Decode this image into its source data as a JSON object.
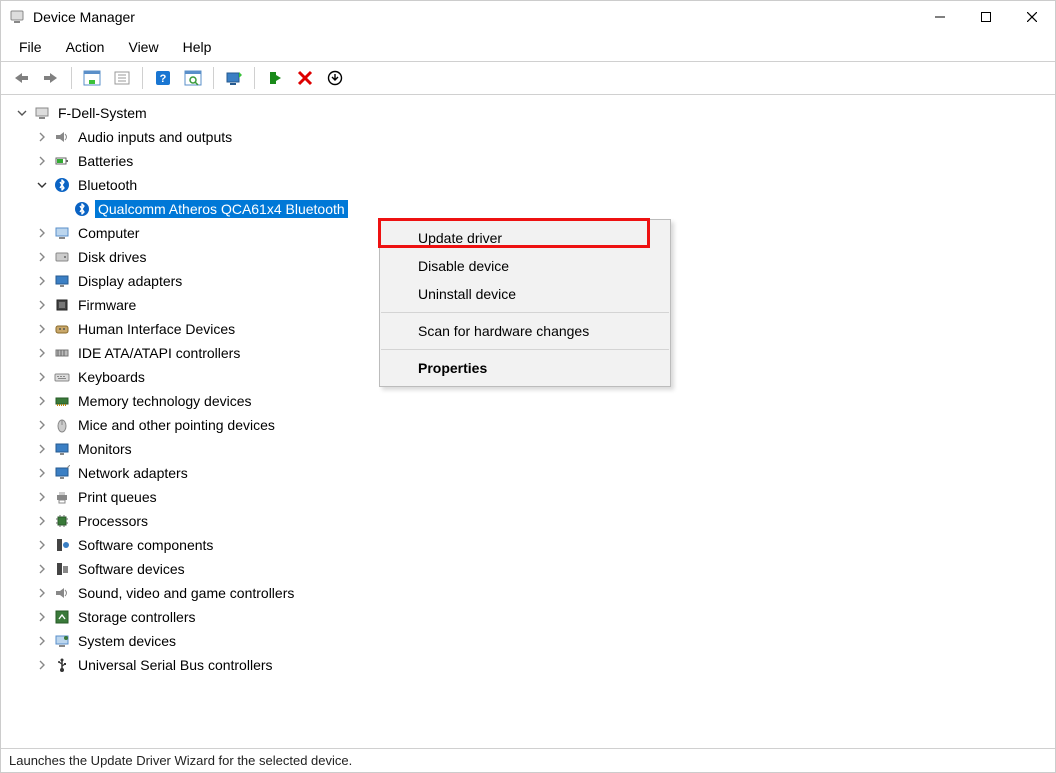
{
  "window": {
    "title": "Device Manager"
  },
  "menubar": [
    "File",
    "Action",
    "View",
    "Help"
  ],
  "statusbar": "Launches the Update Driver Wizard for the selected device.",
  "tree": {
    "root": {
      "label": "F-Dell-System",
      "expanded": true
    },
    "categories": [
      {
        "label": "Audio inputs and outputs",
        "expanded": false,
        "icon": "audio"
      },
      {
        "label": "Batteries",
        "expanded": false,
        "icon": "battery"
      },
      {
        "label": "Bluetooth",
        "expanded": true,
        "icon": "bluetooth",
        "children": [
          {
            "label": "Qualcomm Atheros QCA61x4 Bluetooth",
            "selected": true,
            "icon": "bluetooth"
          }
        ]
      },
      {
        "label": "Computer",
        "expanded": false,
        "icon": "computer"
      },
      {
        "label": "Disk drives",
        "expanded": false,
        "icon": "disk"
      },
      {
        "label": "Display adapters",
        "expanded": false,
        "icon": "display"
      },
      {
        "label": "Firmware",
        "expanded": false,
        "icon": "firmware"
      },
      {
        "label": "Human Interface Devices",
        "expanded": false,
        "icon": "hid"
      },
      {
        "label": "IDE ATA/ATAPI controllers",
        "expanded": false,
        "icon": "ide"
      },
      {
        "label": "Keyboards",
        "expanded": false,
        "icon": "keyboard"
      },
      {
        "label": "Memory technology devices",
        "expanded": false,
        "icon": "memory"
      },
      {
        "label": "Mice and other pointing devices",
        "expanded": false,
        "icon": "mouse"
      },
      {
        "label": "Monitors",
        "expanded": false,
        "icon": "monitor"
      },
      {
        "label": "Network adapters",
        "expanded": false,
        "icon": "network"
      },
      {
        "label": "Print queues",
        "expanded": false,
        "icon": "printer"
      },
      {
        "label": "Processors",
        "expanded": false,
        "icon": "processor"
      },
      {
        "label": "Software components",
        "expanded": false,
        "icon": "swcomp"
      },
      {
        "label": "Software devices",
        "expanded": false,
        "icon": "swdev"
      },
      {
        "label": "Sound, video and game controllers",
        "expanded": false,
        "icon": "sound"
      },
      {
        "label": "Storage controllers",
        "expanded": false,
        "icon": "storage"
      },
      {
        "label": "System devices",
        "expanded": false,
        "icon": "system"
      },
      {
        "label": "Universal Serial Bus controllers",
        "expanded": false,
        "icon": "usb"
      }
    ]
  },
  "context_menu": {
    "items": [
      {
        "label": "Update driver",
        "highlighted": true
      },
      {
        "label": "Disable device"
      },
      {
        "label": "Uninstall device"
      },
      {
        "sep": true
      },
      {
        "label": "Scan for hardware changes"
      },
      {
        "sep": true
      },
      {
        "label": "Properties",
        "bold": true
      }
    ]
  }
}
